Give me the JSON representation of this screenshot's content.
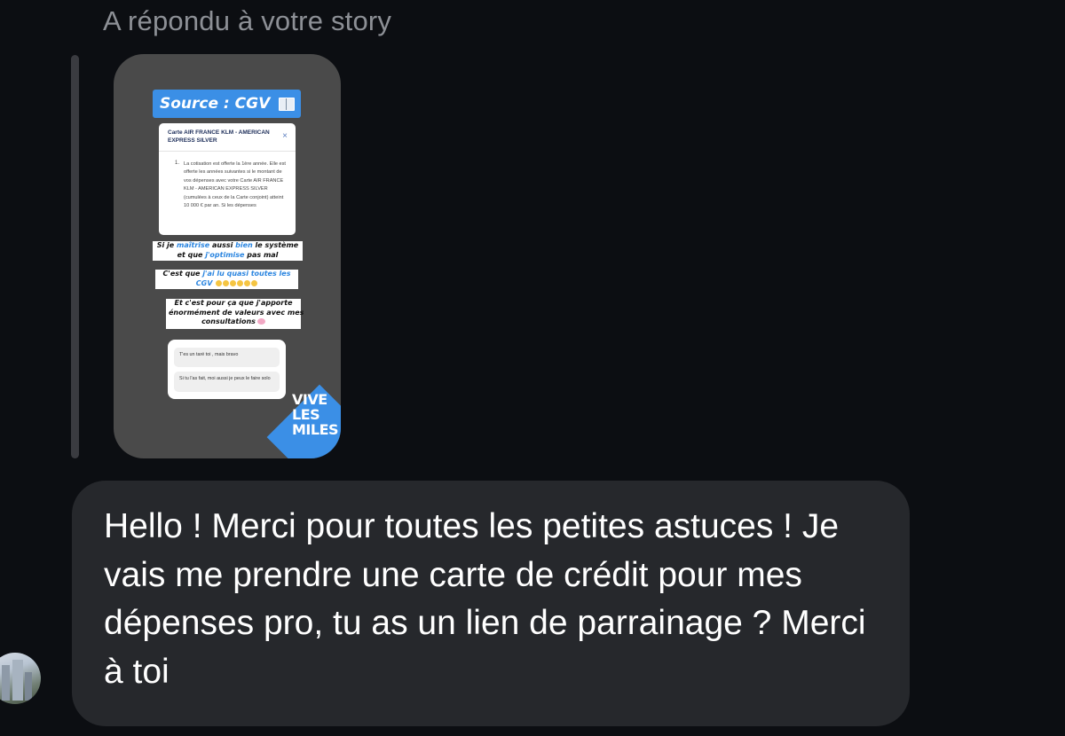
{
  "reply_header": "A répondu à votre story",
  "story": {
    "source_banner": "Source : CGV",
    "book_icon": "book-icon",
    "cgv_card": {
      "title": "Carte AIR FRANCE KLM - AMERICAN EXPRESS SILVER",
      "close": "×",
      "item_number": "1.",
      "body": "La cotisation est offerte la 1ère année. Elle est offerte les années suivantes si le montant de vos dépenses avec votre Carte AIR FRANCE KLM - AMERICAN EXPRESS SILVER (cumulées à ceux de la Carte conjoint) atteint 10 000 € par an. Si les dépenses"
    },
    "sticker1": {
      "a": "Si je ",
      "b": "maîtrise",
      "c": " aussi ",
      "d": "bien",
      "e": " le système",
      "f": "et que ",
      "g": "j'optimise",
      "h": " pas mal"
    },
    "sticker2": {
      "a": "C'est que ",
      "b": "j'ai lu quasi toutes les",
      "c": "CGV"
    },
    "sticker3": {
      "line1": "Et c'est pour ça que j'apporte",
      "line2": "énormément de valeurs avec mes",
      "line3": "consultations"
    },
    "questions": [
      "T'es un taré toi , mais bravo",
      "Si tu l'as fait, moi aussi je peux le faire solo"
    ],
    "badge_lines": [
      "VIVE",
      "LES",
      "MILES"
    ]
  },
  "message": {
    "text": "Hello ! Merci pour toutes les petites astuces ! Je vais me prendre une carte de crédit pour mes dépenses pro, tu as un lien de parrainage ? Merci à toi"
  },
  "avatar_icon": "avatar"
}
